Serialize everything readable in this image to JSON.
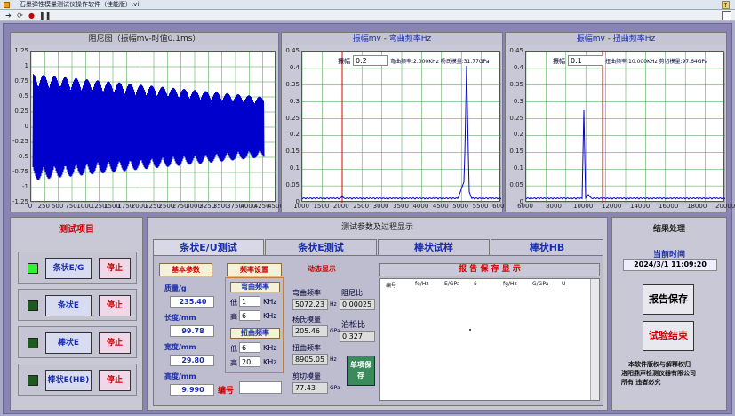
{
  "window": {
    "title": "石墨弹性模量测试仪操作软件（佳能版）.vi"
  },
  "plots": {
    "damping": {
      "title": "阻尼图（振幅mv-时值0.1ms）",
      "y_ticks": [
        "1.25",
        "1",
        "0.75",
        "0.5",
        "0.25",
        "0",
        "-0.25",
        "-0.5",
        "-0.75",
        "-1",
        "-1.25"
      ],
      "x_ticks": [
        "0",
        "250",
        "500",
        "750",
        "1000",
        "1250",
        "1500",
        "1750",
        "2000",
        "2250",
        "2500",
        "2750",
        "3000",
        "3250",
        "3500",
        "3750",
        "4000",
        "4250",
        "4500"
      ]
    },
    "bending": {
      "title": "振幅mv - 弯曲频率Hz",
      "amp_label": "振幅",
      "amp_value": "0.2",
      "info": "弯曲频率:2.000KHz  杨氏模量:31.77GPa",
      "y_ticks": [
        "0.45",
        "0.4",
        "0.35",
        "0.3",
        "0.25",
        "0.2",
        "0.15",
        "0.1",
        "0.05",
        "0"
      ],
      "x_ticks": [
        "1000",
        "1500",
        "2000",
        "2500",
        "3000",
        "3500",
        "4000",
        "4500",
        "5000",
        "5500",
        "6000"
      ]
    },
    "torsion": {
      "title": "振幅mv - 扭曲频率Hz",
      "amp_label": "振幅",
      "amp_value": "0.1",
      "info": "扭曲频率:10.000KHz  剪切模量:97.64GPa",
      "y_ticks": [
        "0.45",
        "0.4",
        "0.35",
        "0.3",
        "0.25",
        "0.2",
        "0.15",
        "0.1",
        "0.05",
        "0"
      ],
      "x_ticks": [
        "6000",
        "8000",
        "10000",
        "12000",
        "14000",
        "16000",
        "18000",
        "20000"
      ]
    }
  },
  "test_items": {
    "title": "测试项目",
    "items": [
      {
        "label": "条状E/G",
        "stop": "停止",
        "led": "#33ee33"
      },
      {
        "label": "条状E",
        "stop": "停止",
        "led": "#1d5a1d"
      },
      {
        "label": "棒状E",
        "stop": "停止",
        "led": "#1d5a1d"
      },
      {
        "label": "棒状E(HB)",
        "stop": "停止",
        "led": "#1d5a1d"
      }
    ]
  },
  "params": {
    "title": "测试参数及过程显示",
    "tabs": [
      "条状E/U测试",
      "条状E测试",
      "棒状试样",
      "棒状HB"
    ],
    "basic_title": "基本参数",
    "mass_label": "质量/g",
    "mass": "235.40",
    "length_label": "长度/mm",
    "length": "99.78",
    "width_label": "宽度/mm",
    "width": "29.80",
    "height_label": "高度/mm",
    "height": "9.990",
    "serial_label": "编号",
    "serial": "",
    "freq_title": "频率设置",
    "bend_title": "弯曲频率",
    "bend_low_label": "低",
    "bend_low": "1",
    "bend_high_label": "高",
    "bend_high": "6",
    "khz": "KHz",
    "tor_title": "扭曲频率",
    "tor_low_label": "低",
    "tor_low": "6",
    "tor_high_label": "高",
    "tor_high": "20",
    "dyn_title": "动态显示",
    "bend_freq_label": "弯曲频率",
    "bend_freq": "5072.23",
    "hz": "Hz",
    "damping_label": "阻尼比",
    "damping": "0.00025",
    "young_label": "杨氏模量",
    "young": "205.46",
    "gpa": "GPa",
    "poisson_label": "泊松比",
    "poisson": "0.327",
    "tor_freq_label": "扭曲频率",
    "tor_freq": "8905.05",
    "shear_label": "剪切模量",
    "shear": "77.43",
    "single_save": "单项保存",
    "report_title": "报 告 保 存 显 示",
    "report_cols": [
      "编号",
      "fe/Hz",
      "E/GPa",
      "δ",
      "fg/Hz",
      "G/GPa",
      "U"
    ]
  },
  "results": {
    "title": "结果处理",
    "time_label": "当前时间",
    "time": "2024/3/1 11:09:20",
    "save_report": "报告保存",
    "end_test": "试验结束",
    "copyright1": "本软件版权与解释权归",
    "copyright2": "洛阳鼎声检测仪器有限公司",
    "copyright3": "所有  违者必究"
  }
}
